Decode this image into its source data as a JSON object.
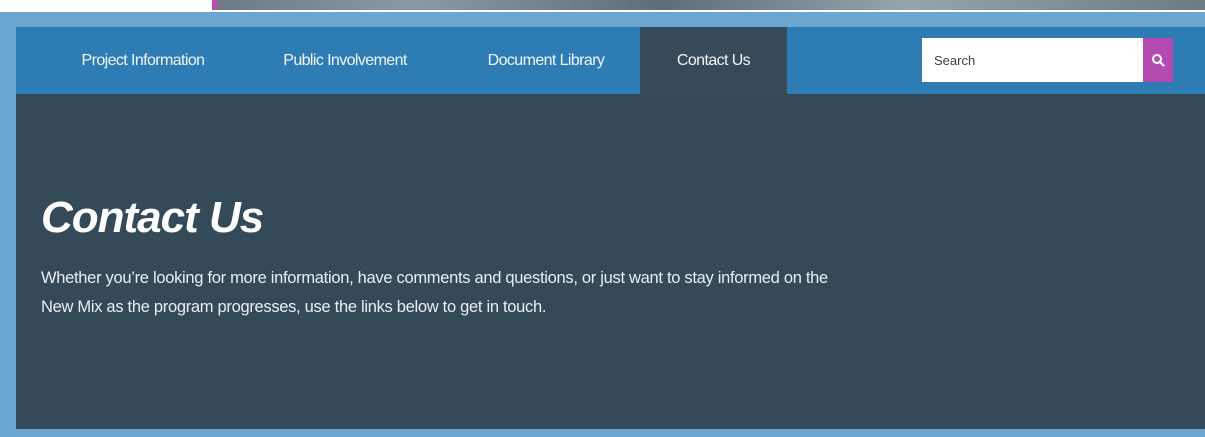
{
  "nav": {
    "items": [
      {
        "label": "Project Information",
        "active": false
      },
      {
        "label": "Public Involvement",
        "active": false
      },
      {
        "label": "Document Library",
        "active": false
      },
      {
        "label": "Contact Us",
        "active": true
      }
    ],
    "search_placeholder": "Search",
    "search_icon": "search-icon"
  },
  "main": {
    "title": "Contact Us",
    "intro": "Whether you’re looking for more information, have comments and questions, or just want to stay informed on the New Mix as the program progresses, use the links below to get in touch."
  },
  "colors": {
    "nav_bg": "#2d7db4",
    "active_tab_bg": "#374a5a",
    "content_bg": "#344a59",
    "search_button": "#b44bb0",
    "frame": "#6aa6cf"
  }
}
